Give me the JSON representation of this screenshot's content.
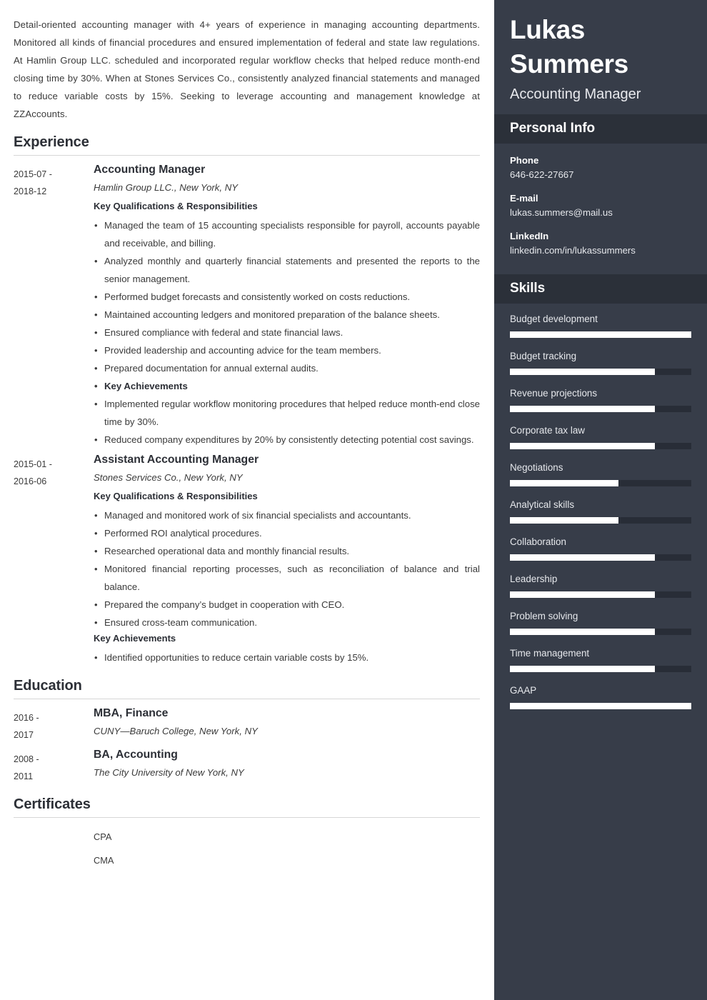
{
  "summary": {
    "text": "Detail-oriented accounting manager with 4+ years of experience in managing accounting departments. Monitored all kinds of financial procedures and ensured implementation of federal and state law regulations. At Hamlin Group LLC. scheduled and incorporated regular workflow checks that helped reduce month-end closing time by 30%. When at Stones Services Co., consistently analyzed financial statements and managed to reduce variable costs by 15%. Seeking to leverage accounting and management knowledge at ZZAccounts."
  },
  "experience": {
    "heading": "Experience",
    "entries": [
      {
        "date_start": "2015-07 -",
        "date_end": "2018-12",
        "title": "Accounting Manager",
        "org": "Hamlin Group LLC., New York, NY",
        "sub_head": "Key Qualifications & Responsibilities",
        "bullets": [
          "Managed the team of 15 accounting specialists responsible for payroll, accounts payable and receivable, and billing.",
          "Analyzed monthly and quarterly financial statements and presented the reports to the senior management.",
          "Performed budget forecasts and consistently worked on costs reductions.",
          "Maintained accounting ledgers and monitored preparation of the balance sheets.",
          "Ensured compliance with federal and state financial laws.",
          "Provided leadership and accounting advice for the team members.",
          "Prepared documentation for annual external audits."
        ],
        "achievements_inline_label": "Key Achievements",
        "achievements": [
          "Implemented regular workflow monitoring procedures that helped reduce month-end close time by 30%.",
          "Reduced company expenditures by 20% by consistently detecting potential cost savings."
        ]
      },
      {
        "date_start": "2015-01 -",
        "date_end": "2016-06",
        "title": "Assistant Accounting Manager",
        "org": "Stones Services Co., New York, NY",
        "sub_head": "Key Qualifications & Responsibilities",
        "bullets": [
          "Managed and monitored work of six financial specialists and accountants.",
          "Performed ROI analytical procedures.",
          "Researched operational data and monthly financial results.",
          "Monitored financial reporting processes, such as reconciliation of balance and trial balance.",
          "Prepared the company’s budget in cooperation with CEO.",
          "Ensured cross-team communication."
        ],
        "achievements_heading": "Key Achievements",
        "achievements": [
          "Identified opportunities to reduce certain variable costs by 15%."
        ]
      }
    ]
  },
  "education": {
    "heading": "Education",
    "entries": [
      {
        "date_start": "2016 -",
        "date_end": "2017",
        "title": "MBA, Finance",
        "org": "CUNY—Baruch College, New York, NY"
      },
      {
        "date_start": "2008 -",
        "date_end": "2011",
        "title": "BA, Accounting",
        "org": "The City University of New York, NY"
      }
    ]
  },
  "certificates": {
    "heading": "Certificates",
    "items": [
      "CPA",
      "CMA"
    ]
  },
  "sidebar": {
    "name": "Lukas Summers",
    "role": "Accounting Manager",
    "personal_info": {
      "heading": "Personal Info",
      "items": [
        {
          "label": "Phone",
          "value": "646-622-27667"
        },
        {
          "label": "E-mail",
          "value": "lukas.summers@mail.us"
        },
        {
          "label": "LinkedIn",
          "value": "linkedin.com/in/lukassummers"
        }
      ]
    },
    "skills": {
      "heading": "Skills",
      "items": [
        {
          "name": "Budget development",
          "level": 100
        },
        {
          "name": "Budget tracking",
          "level": 80
        },
        {
          "name": "Revenue projections",
          "level": 80
        },
        {
          "name": "Corporate tax law",
          "level": 80
        },
        {
          "name": "Negotiations",
          "level": 60
        },
        {
          "name": "Analytical skills",
          "level": 60
        },
        {
          "name": "Collaboration",
          "level": 80
        },
        {
          "name": "Leadership",
          "level": 80
        },
        {
          "name": "Problem solving",
          "level": 80
        },
        {
          "name": "Time management",
          "level": 80
        },
        {
          "name": "GAAP",
          "level": 100
        }
      ]
    }
  },
  "colors": {
    "sidebar_bg": "#373d49",
    "sidebar_band": "#2b3039",
    "skill_track": "#282d37",
    "skill_fill": "#ffffff",
    "rule": "#d6d6d6",
    "text": "#3a3a3a"
  }
}
